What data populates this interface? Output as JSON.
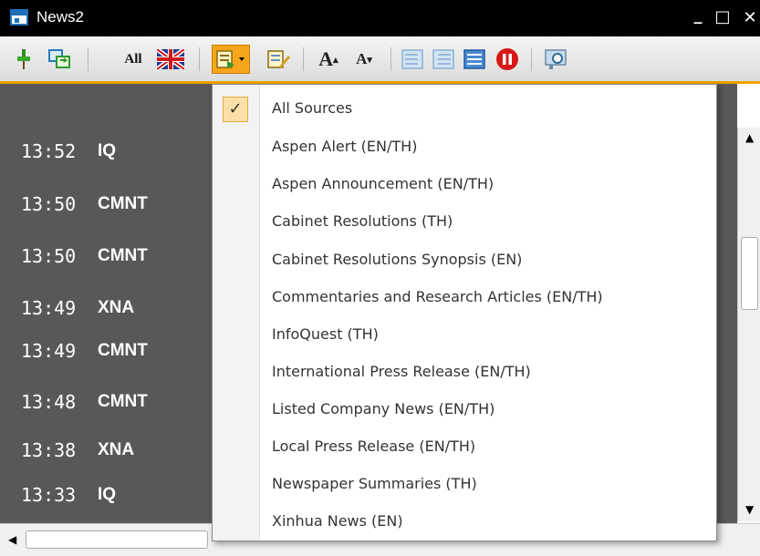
{
  "window": {
    "title": "News2",
    "minimize": "_",
    "maximize": "□",
    "close": "✕"
  },
  "toolbar": {
    "all_label": "All",
    "font_larger": "A",
    "font_smaller": "A"
  },
  "news": [
    {
      "time": "13:52",
      "code": "IQ"
    },
    {
      "time": "13:50",
      "code": "CMNT"
    },
    {
      "time": "13:50",
      "code": "CMNT"
    },
    {
      "time": "13:49",
      "code": "XNA"
    },
    {
      "time": "13:49",
      "code": "CMNT"
    },
    {
      "time": "13:48",
      "code": "CMNT"
    },
    {
      "time": "13:38",
      "code": "XNA"
    },
    {
      "time": "13:33",
      "code": "IQ"
    }
  ],
  "source_menu": {
    "check_mark": "✓",
    "items": [
      {
        "label": "All Sources",
        "checked": true
      },
      {
        "label": "Aspen Alert (EN/TH)",
        "checked": false
      },
      {
        "label": "Aspen Announcement (EN/TH)",
        "checked": false
      },
      {
        "label": "Cabinet Resolutions (TH)",
        "checked": false
      },
      {
        "label": "Cabinet Resolutions Synopsis (EN)",
        "checked": false
      },
      {
        "label": "Commentaries and Research Articles (EN/TH)",
        "checked": false
      },
      {
        "label": "InfoQuest (TH)",
        "checked": false
      },
      {
        "label": "International Press Release (EN/TH)",
        "checked": false
      },
      {
        "label": "Listed Company News (EN/TH)",
        "checked": false
      },
      {
        "label": "Local Press Release (EN/TH)",
        "checked": false
      },
      {
        "label": "Newspaper Summaries (TH)",
        "checked": false
      },
      {
        "label": "Xinhua News (EN)",
        "checked": false
      }
    ]
  },
  "colors": {
    "accent": "#f2a100",
    "list_background": "#585858",
    "titlebar": "#000000"
  },
  "icons": [
    "pin-icon",
    "refresh-icon",
    "all-sources-icon",
    "uk-flag-icon",
    "source-filter-icon",
    "edit-icon",
    "font-larger-icon",
    "font-smaller-icon",
    "previous-icon",
    "next-icon",
    "export-icon",
    "stop-icon",
    "search-icon"
  ]
}
